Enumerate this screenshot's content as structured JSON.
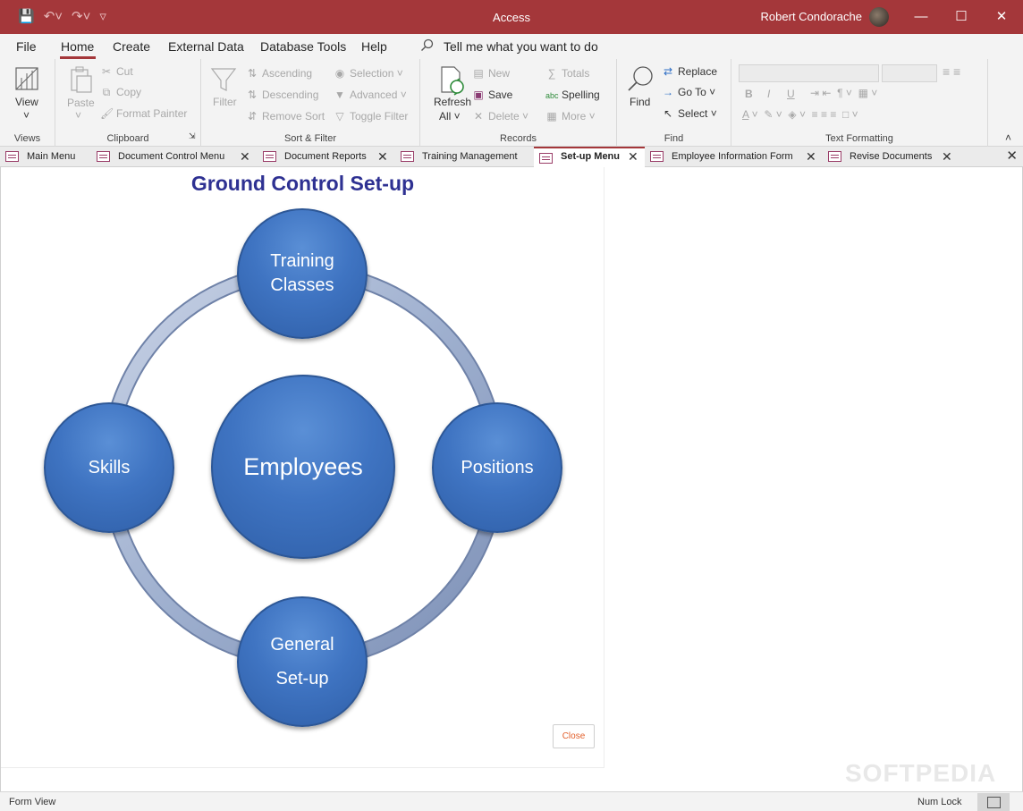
{
  "window": {
    "app_title": "Access",
    "user_name": "Robert Condorache",
    "minimize_glyph": "—",
    "maximize_glyph": "☐",
    "close_glyph": "✕"
  },
  "quick_access": {
    "save_icon": "save-icon",
    "undo_icon": "undo-icon",
    "redo_icon": "redo-icon",
    "customize_icon": "customize-icon"
  },
  "menu": {
    "file": "File",
    "home": "Home",
    "create": "Create",
    "external_data": "External Data",
    "database_tools": "Database Tools",
    "help": "Help",
    "search_placeholder": "Tell me what you want to do"
  },
  "ribbon": {
    "views": {
      "label": "Views",
      "view": "View"
    },
    "clipboard": {
      "label": "Clipboard",
      "paste": "Paste",
      "cut": "Cut",
      "copy": "Copy",
      "format_painter": "Format Painter"
    },
    "sort_filter": {
      "label": "Sort & Filter",
      "filter": "Filter",
      "ascending": "Ascending",
      "descending": "Descending",
      "remove_sort": "Remove Sort",
      "selection": "Selection",
      "advanced": "Advanced",
      "toggle_filter": "Toggle Filter"
    },
    "records": {
      "label": "Records",
      "refresh": "Refresh",
      "refresh_all": "All",
      "new": "New",
      "save": "Save",
      "delete": "Delete",
      "totals": "Totals",
      "spelling": "Spelling",
      "more": "More"
    },
    "find": {
      "label": "Find",
      "find": "Find",
      "replace": "Replace",
      "go_to": "Go To",
      "select": "Select"
    },
    "text_formatting": {
      "label": "Text Formatting"
    }
  },
  "tabs": [
    {
      "label": "Main Menu",
      "closable": false
    },
    {
      "label": "Document Control Menu",
      "closable": true
    },
    {
      "label": "Document Reports",
      "closable": true
    },
    {
      "label": "Training Management",
      "closable": false
    },
    {
      "label": "Set-up Menu",
      "closable": true,
      "active": true
    },
    {
      "label": "Employee Information Form",
      "closable": true
    },
    {
      "label": "Revise Documents",
      "closable": true
    }
  ],
  "form": {
    "title": "Ground Control Set-up",
    "center": "Employees",
    "top_line1": "Training",
    "top_line2": "Classes",
    "left": "Skills",
    "right": "Positions",
    "bottom_line1": "General",
    "bottom_line2": "Set-up",
    "close_button": "Close"
  },
  "watermark": "SOFTPEDIA",
  "status": {
    "left": "Form View",
    "num_lock": "Num Lock"
  },
  "colors": {
    "brand": "#a4373a",
    "title_text": "#2e3192",
    "circle_blue": "#3f74c2",
    "close_text": "#e2602c"
  }
}
